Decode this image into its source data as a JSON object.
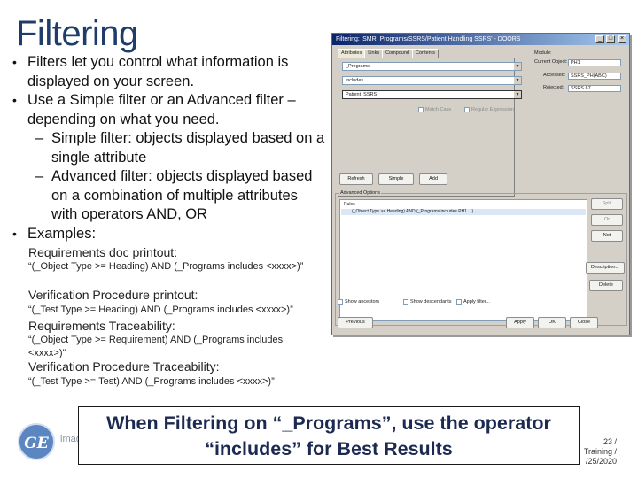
{
  "slide": {
    "title": "Filtering",
    "bullets": [
      {
        "level": 1,
        "text": "Filters let you control what information is displayed on your screen."
      },
      {
        "level": 1,
        "text": "Use a Simple filter or an Advanced filter – depending on what you need."
      },
      {
        "level": 2,
        "text": "Simple filter: objects displayed based on a single attribute"
      },
      {
        "level": 2,
        "text": "Advanced filter: objects displayed based on a combination of multiple attributes with operators AND, OR"
      },
      {
        "level": 1,
        "text": "Examples:"
      }
    ],
    "examples": [
      {
        "label": "Requirements doc printout:",
        "code": "“(_Object Type >= Heading) AND (_Programs includes <xxxx>)”"
      },
      {
        "label": "Verification Procedure printout:",
        "code": "“(_Test Type >= Heading) AND (_Programs includes <xxxx>)”"
      },
      {
        "label": "Requirements Traceability:",
        "code": "“(_Object Type >= Requirement) AND (_Programs includes <xxxx>)”"
      },
      {
        "label": "Verification Procedure Traceability:",
        "code": "“(_Test Type >= Test) AND (_Programs includes <xxxx>)”"
      }
    ],
    "callout": "When Filtering on “_Programs”, use the operator “includes” for Best Results",
    "footer": {
      "logo": "GE",
      "brand": "imag",
      "page": "23 /",
      "line2": "Training /",
      "line3": "/25/2020"
    }
  },
  "dialog": {
    "title": "Filtering: 'SMR_Programs/SSRS/Patient Handling SSRS' - DOORS",
    "title_buttons": [
      "_",
      "□",
      "×"
    ],
    "tabs": [
      "Attributes",
      "Links",
      "Compound",
      "Contents"
    ],
    "active_tab": "Attributes",
    "attribute_select": "_Programs",
    "condition_select": "includes",
    "value_field": "Patient_SSRS",
    "checkboxes_left": [
      "Match Case",
      "Regular Expression"
    ],
    "right_fields": [
      {
        "label": "Module:",
        "value": ""
      },
      {
        "label": "Current Object:",
        "value": "PH1"
      },
      {
        "label": "Accessed:",
        "value": "SSRS_PH(ABC)"
      },
      {
        "label": "Rejected:",
        "value": "SSRS 67"
      }
    ],
    "action_buttons": [
      "Refresh",
      "Simple",
      "Add"
    ],
    "advanced_label": "Advanced Options",
    "list_rows": [
      "Rules",
      "(_Object Type >= Heading) AND (_Programs includes PH1 ...)"
    ],
    "side_buttons": [
      "Split",
      "Or",
      "Not",
      "Description...",
      "Delete"
    ],
    "bottom_checkboxes": [
      "Show ancestors",
      "Show descendants",
      "Apply filter..."
    ],
    "bottom_buttons": [
      "Previous",
      "Apply",
      "OK",
      "Close"
    ]
  }
}
